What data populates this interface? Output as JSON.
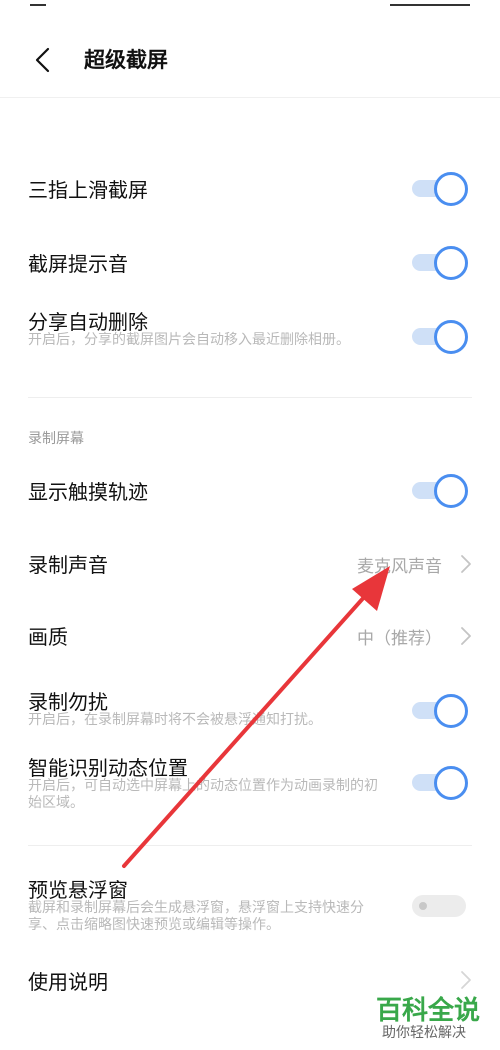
{
  "header": {
    "title": "超级截屏"
  },
  "settings": {
    "three_finger": {
      "label": "三指上滑截屏",
      "enabled": true
    },
    "sound": {
      "label": "截屏提示音",
      "enabled": true
    },
    "share_delete": {
      "label": "分享自动删除",
      "desc": "开启后，分享的截屏图片会自动移入最近删除相册。",
      "enabled": true
    }
  },
  "record": {
    "section_title": "录制屏幕",
    "touch_track": {
      "label": "显示触摸轨迹",
      "enabled": true
    },
    "record_sound": {
      "label": "录制声音",
      "value": "麦克风声音"
    },
    "quality": {
      "label": "画质",
      "value": "中（推荐）"
    },
    "dnd": {
      "label": "录制勿扰",
      "desc": "开启后，在录制屏幕时将不会被悬浮通知打扰。",
      "enabled": true
    },
    "smart_position": {
      "label": "智能识别动态位置",
      "desc": "开启后，可自动选中屏幕上的动态位置作为动画录制的初始区域。",
      "enabled": true
    }
  },
  "preview": {
    "label": "预览悬浮窗",
    "desc": "截屏和录制屏幕后会生成悬浮窗，悬浮窗上支持快速分享、点击缩略图快速预览或编辑等操作。",
    "enabled": false
  },
  "help": {
    "label": "使用说明"
  },
  "watermark": {
    "main": "百科全说",
    "sub": "助你轻松解决"
  },
  "colors": {
    "accent": "#4a8ef0",
    "annotation_arrow": "#e8363a",
    "watermark": "#39a84a"
  }
}
